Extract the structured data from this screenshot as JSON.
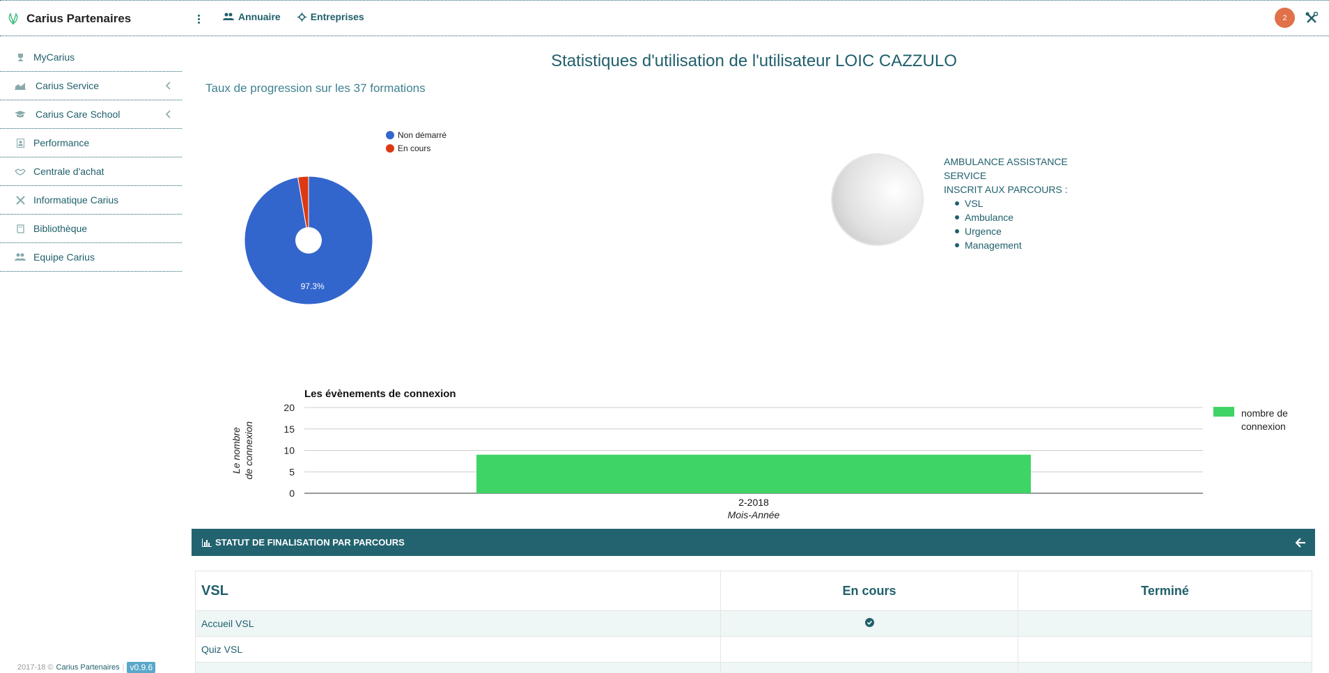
{
  "header": {
    "app_title": "Carius Partenaires",
    "nav": [
      {
        "label": "Annuaire",
        "icon": "users-icon"
      },
      {
        "label": "Entreprises",
        "icon": "crosshair-icon"
      }
    ],
    "notification_count": "2",
    "accent_color": "#1f5f6b",
    "badge_color": "#e07148"
  },
  "sidebar": {
    "items": [
      {
        "label": "MyCarius",
        "icon": "trophy-icon",
        "has_chevron": false
      },
      {
        "label": "Carius Service",
        "icon": "area-chart-icon",
        "has_chevron": true
      },
      {
        "label": "Carius Care School",
        "icon": "graduation-cap-icon",
        "has_chevron": true
      },
      {
        "label": "Performance",
        "icon": "id-badge-icon",
        "has_chevron": false
      },
      {
        "label": "Centrale d'achat",
        "icon": "handshake-icon",
        "has_chevron": false
      },
      {
        "label": "Informatique Carius",
        "icon": "tools-icon",
        "has_chevron": false
      },
      {
        "label": "Bibliothèque",
        "icon": "book-icon",
        "has_chevron": false
      },
      {
        "label": "Equipe Carius",
        "icon": "users-icon",
        "has_chevron": false
      }
    ],
    "footer": {
      "copyright": "2017-18 ©",
      "link": "Carius Partenaires",
      "version": "v0.9.6"
    }
  },
  "main": {
    "title": "Statistiques d'utilisation de l'utilisateur LOIC CAZZULO",
    "progress_subtitle": "Taux de progression sur les 37 formations",
    "profile": {
      "company": "AMBULANCE ASSISTANCE",
      "company_line2": "SERVICE",
      "parcours_label": "INSCRIT AUX PARCOURS :",
      "parcours": [
        "VSL",
        "Ambulance",
        "Urgence",
        "Management"
      ]
    },
    "status_panel": {
      "title": "STATUT DE FINALISATION PAR PARCOURS",
      "table": {
        "headers": [
          "VSL",
          "En cours",
          "Terminé"
        ],
        "rows": [
          {
            "name": "Accueil VSL",
            "en_cours": true,
            "termine": false
          },
          {
            "name": "Quiz VSL",
            "en_cours": false,
            "termine": false
          },
          {
            "name": "",
            "en_cours": false,
            "termine": false
          }
        ]
      }
    }
  },
  "chart_data": [
    {
      "type": "pie",
      "labels": [
        "Non démarré",
        "En cours"
      ],
      "values": [
        97.3,
        2.7
      ],
      "colors": [
        "#3366cc",
        "#dc3912"
      ],
      "slice_labels": [
        "97.3%",
        ""
      ],
      "legend_position": "top-right",
      "donut_hole": true
    },
    {
      "type": "bar",
      "title": "Les évènements de connexion",
      "categories": [
        "2-2018"
      ],
      "series": [
        {
          "name": "nombre de connexion",
          "values": [
            9
          ],
          "color": "#3fd466"
        }
      ],
      "xlabel": "Mois-Année",
      "ylabel": "Le nombre de connexion",
      "ylim": [
        0,
        20
      ],
      "yticks": [
        "0",
        "5",
        "10",
        "15",
        "20"
      ],
      "grid": true,
      "legend_position": "right"
    }
  ]
}
